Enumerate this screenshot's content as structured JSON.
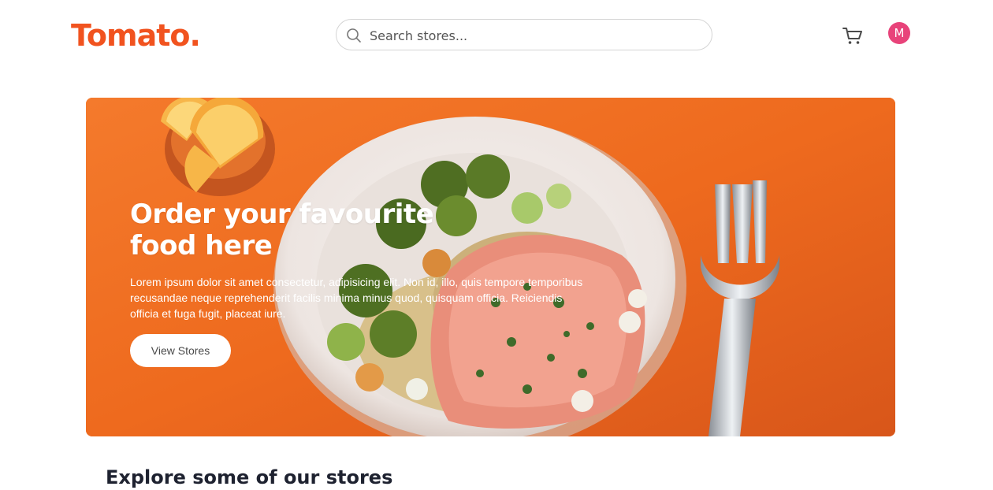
{
  "brand": {
    "logo_text": "Tomato.",
    "accent_color": "#f1531f"
  },
  "header": {
    "search_placeholder": "Search stores...",
    "search_icon": "search-icon",
    "cart_icon": "cart-icon",
    "avatar_initial": "M",
    "avatar_color": "#e8437a"
  },
  "hero": {
    "title": "Order your favourite food here",
    "description": "Lorem ipsum dolor sit amet consectetur, adipisicing elit. Non id, illo, quis tempore temporibus recusandae neque reprehenderit facilis minima minus quod, quisquam officia. Reiciendis officia et fuga fugit, placeat iure.",
    "button_label": "View Stores",
    "background_color": "#ee6a1f"
  },
  "stores_section": {
    "heading": "Explore some of our stores"
  }
}
